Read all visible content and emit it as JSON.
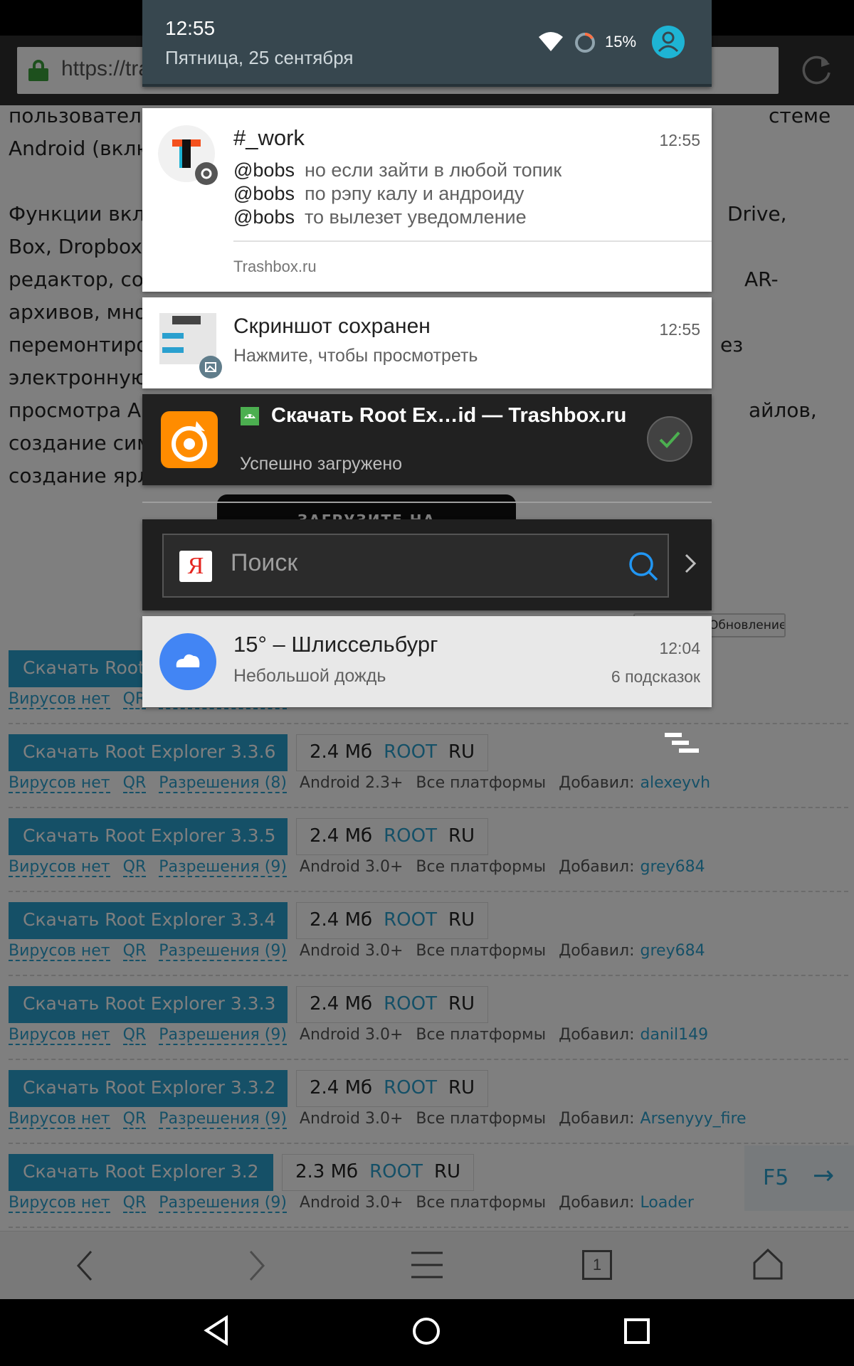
{
  "status_bar": {
    "time": "12:55",
    "date": "Пятница, 25 сентября",
    "battery_percent": "15%"
  },
  "browser": {
    "url_text": "https://tra",
    "article": {
      "line1_left": "пользователе",
      "line1_right": "стеме",
      "line2": "Android (вклю",
      "para2": [
        {
          "left": "Функции вклю",
          "right": "Drive,"
        },
        {
          "left": "Box, Dropbox",
          "right": ""
        },
        {
          "left": "редактор, созд",
          "right": "AR-"
        },
        {
          "left": "архивов, множ",
          "right": ""
        },
        {
          "left": "перемонтиро",
          "right": "ез"
        },
        {
          "left": "электронную",
          "right": ""
        },
        {
          "left": "просмотра AP",
          "right": "айлов,"
        },
        {
          "left": "создание сим",
          "right": ""
        },
        {
          "left": "создание ярлы",
          "right": ""
        }
      ]
    },
    "store_badge_text": "ЗАГРУЗИТЕ НА",
    "update_pill": "Обновление",
    "downloads": [
      {
        "button": "Скачать Root",
        "size": "",
        "root": "",
        "lang": "",
        "viruses": "Вирусов нет",
        "qr": "QR",
        "permissions": "Разрешения (9)",
        "android": "",
        "platforms": "",
        "added_by_label": "",
        "user": ""
      },
      {
        "button": "Скачать Root Explorer 3.3.6",
        "size": "2.4 Мб",
        "root": "ROOT",
        "lang": "RU",
        "viruses": "Вирусов нет",
        "qr": "QR",
        "permissions": "Разрешения (8)",
        "android": "Android 2.3+",
        "platforms": "Все платформы",
        "added_by_label": "Добавил:",
        "user": "alexeyvh"
      },
      {
        "button": "Скачать Root Explorer 3.3.5",
        "size": "2.4 Мб",
        "root": "ROOT",
        "lang": "RU",
        "viruses": "Вирусов нет",
        "qr": "QR",
        "permissions": "Разрешения (9)",
        "android": "Android 3.0+",
        "platforms": "Все платформы",
        "added_by_label": "Добавил:",
        "user": "grey684"
      },
      {
        "button": "Скачать Root Explorer 3.3.4",
        "size": "2.4 Мб",
        "root": "ROOT",
        "lang": "RU",
        "viruses": "Вирусов нет",
        "qr": "QR",
        "permissions": "Разрешения (9)",
        "android": "Android 3.0+",
        "platforms": "Все платформы",
        "added_by_label": "Добавил:",
        "user": "grey684"
      },
      {
        "button": "Скачать Root Explorer 3.3.3",
        "size": "2.4 Мб",
        "root": "ROOT",
        "lang": "RU",
        "viruses": "Вирусов нет",
        "qr": "QR",
        "permissions": "Разрешения (9)",
        "android": "Android 3.0+",
        "platforms": "Все платформы",
        "added_by_label": "Добавил:",
        "user": "danil149"
      },
      {
        "button": "Скачать Root Explorer 3.3.2",
        "size": "2.4 Мб",
        "root": "ROOT",
        "lang": "RU",
        "viruses": "Вирусов нет",
        "qr": "QR",
        "permissions": "Разрешения (9)",
        "android": "Android 3.0+",
        "platforms": "Все платформы",
        "added_by_label": "Добавил:",
        "user": "Arsenyyy_fire"
      },
      {
        "button": "Скачать Root Explorer 3.2",
        "size": "2.3 Мб",
        "root": "ROOT",
        "lang": "RU",
        "viruses": "Вирусов нет",
        "qr": "QR",
        "permissions": "Разрешения (9)",
        "android": "Android 3.0+",
        "platforms": "Все платформы",
        "added_by_label": "Добавил:",
        "user": "Loader"
      }
    ],
    "f5_label": "F5",
    "f5_arrow": "→",
    "tab_count": "1"
  },
  "notifications": {
    "chat": {
      "title": "#_work",
      "time": "12:55",
      "messages": [
        {
          "user": "@bobs",
          "text": "но если зайти в любой топик"
        },
        {
          "user": "@bobs",
          "text": "по рэпу калу и андроиду"
        },
        {
          "user": "@bobs",
          "text": "то вылезет уведомление"
        }
      ],
      "source": "Trashbox.ru"
    },
    "screenshot": {
      "title": "Скриншот сохранен",
      "time": "12:55",
      "text": "Нажмите, чтобы просмотреть"
    },
    "download": {
      "title": "Скачать Root Ex…id — Trashbox.ru",
      "text": "Успешно загружено"
    },
    "search": {
      "logo": "Я",
      "placeholder": "Поиск"
    },
    "weather": {
      "title": "15° – Шлиссельбург",
      "time": "12:04",
      "text": "Небольшой дождь",
      "hints": "6 подсказок"
    }
  },
  "colors": {
    "shade_header": "#37474f",
    "accent_blue": "#2aa0cf",
    "download_check": "#4caf50",
    "uc_orange": "#ff8c00",
    "weather_blue": "#4285f4",
    "user_avatar": "#1eb4d4"
  }
}
